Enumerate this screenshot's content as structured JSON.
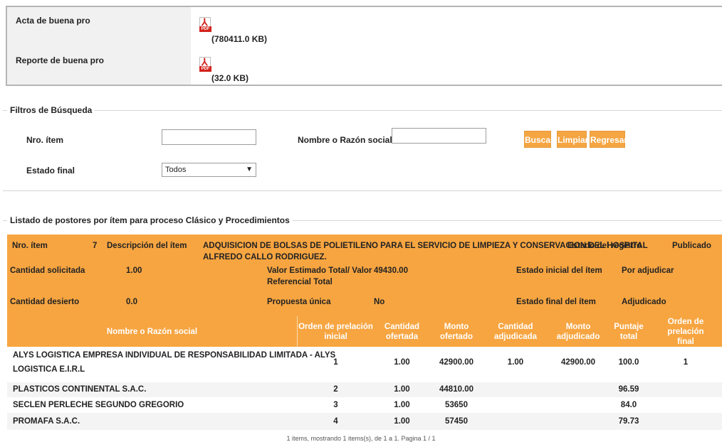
{
  "documents": [
    {
      "label": "Acta de buena pro",
      "icon": "pdf-icon",
      "size": "(780411.0 KB)"
    },
    {
      "label": "Reporte de buena pro",
      "icon": "pdf-icon",
      "size": "(32.0 KB)"
    }
  ],
  "filters": {
    "legend": "Filtros de Búsqueda",
    "item_label": "Nro. ítem",
    "item_value": "",
    "name_label": "Nombre o Razón social",
    "name_value": "",
    "estado_label": "Estado final",
    "estado_value": "Todos",
    "buscar": "Buscar",
    "limpiar": "Limpiar",
    "regresar": "Regresar"
  },
  "listing": {
    "legend": "Listado de postores por ítem para proceso Clásico y Procedimientos",
    "item_label": "Nro. ítem",
    "item_value": "7",
    "desc_label": "Descripción del ítem",
    "desc_line1": "ADQUISICION DE BOLSAS DE POLIETILENO PARA EL SERVICIO DE LIMPIEZA Y CONSERVACION DEL HOSPITAL",
    "desc_line2": "ALFREDO CALLO RODRIGUEZ.",
    "estado_registro_label": "Estado del registro",
    "estado_registro_value": "Publicado",
    "cantidad_solicitada_label": "Cantidad solicitada",
    "cantidad_solicitada_value": "1.00",
    "valor_label_1": "Valor Estimado Total/ Valor",
    "valor_label_2": "Referencial Total",
    "valor_value": "49430.00",
    "estado_inicial_label": "Estado inicial del ítem",
    "estado_inicial_value": "Por adjudicar",
    "cantidad_desierto_label": "Cantidad desierto",
    "cantidad_desierto_value": "0.0",
    "propuesta_label": "Propuesta única",
    "propuesta_value": "No",
    "estado_final_label": "Estado final del ítem",
    "estado_final_value": "Adjudicado"
  },
  "table": {
    "headers": {
      "nombre": "Nombre o Razón social",
      "orden_inicial_1": "Orden de prelación",
      "orden_inicial_2": "inicial",
      "cantidad_ofertada_1": "Cantidad",
      "cantidad_ofertada_2": "ofertada",
      "monto_ofertado_1": "Monto",
      "monto_ofertado_2": "ofertado",
      "cantidad_adjudicada_1": "Cantidad",
      "cantidad_adjudicada_2": "adjudicada",
      "monto_adjudicado_1": "Monto",
      "monto_adjudicado_2": "adjudicado",
      "puntaje_1": "Puntaje",
      "puntaje_2": "total",
      "orden_final_1": "Orden de prelación",
      "orden_final_2": "final"
    },
    "rows": [
      {
        "nombre_1": "ALYS LOGISTICA EMPRESA INDIVIDUAL DE RESPONSABILIDAD LIMITADA - ALYS",
        "nombre_2": "LOGISTICA E.I.R.L",
        "orden_inicial": "1",
        "cantidad_ofertada": "1.00",
        "monto_ofertado": "42900.00",
        "cantidad_adjudicada": "1.00",
        "monto_adjudicado": "42900.00",
        "puntaje": "100.0",
        "orden_final": "1"
      },
      {
        "nombre_1": "PLASTICOS CONTINENTAL S.A.C.",
        "nombre_2": "",
        "orden_inicial": "2",
        "cantidad_ofertada": "1.00",
        "monto_ofertado": "44810.00",
        "cantidad_adjudicada": "",
        "monto_adjudicado": "",
        "puntaje": "96.59",
        "orden_final": ""
      },
      {
        "nombre_1": "SECLEN PERLECHE SEGUNDO GREGORIO",
        "nombre_2": "",
        "orden_inicial": "3",
        "cantidad_ofertada": "1.00",
        "monto_ofertado": "53650",
        "cantidad_adjudicada": "",
        "monto_adjudicado": "",
        "puntaje": "84.0",
        "orden_final": ""
      },
      {
        "nombre_1": "PROMAFA S.A.C.",
        "nombre_2": "",
        "orden_inicial": "4",
        "cantidad_ofertada": "1.00",
        "monto_ofertado": "57450",
        "cantidad_adjudicada": "",
        "monto_adjudicado": "",
        "puntaje": "79.73",
        "orden_final": ""
      }
    ]
  },
  "footer": "1 items, mostrando 1 items(s), de 1 a 1. Pagina 1 / 1",
  "colors": {
    "accent": "#f7a541",
    "button": "#f5a542",
    "pdf_red": "#d2231c"
  }
}
